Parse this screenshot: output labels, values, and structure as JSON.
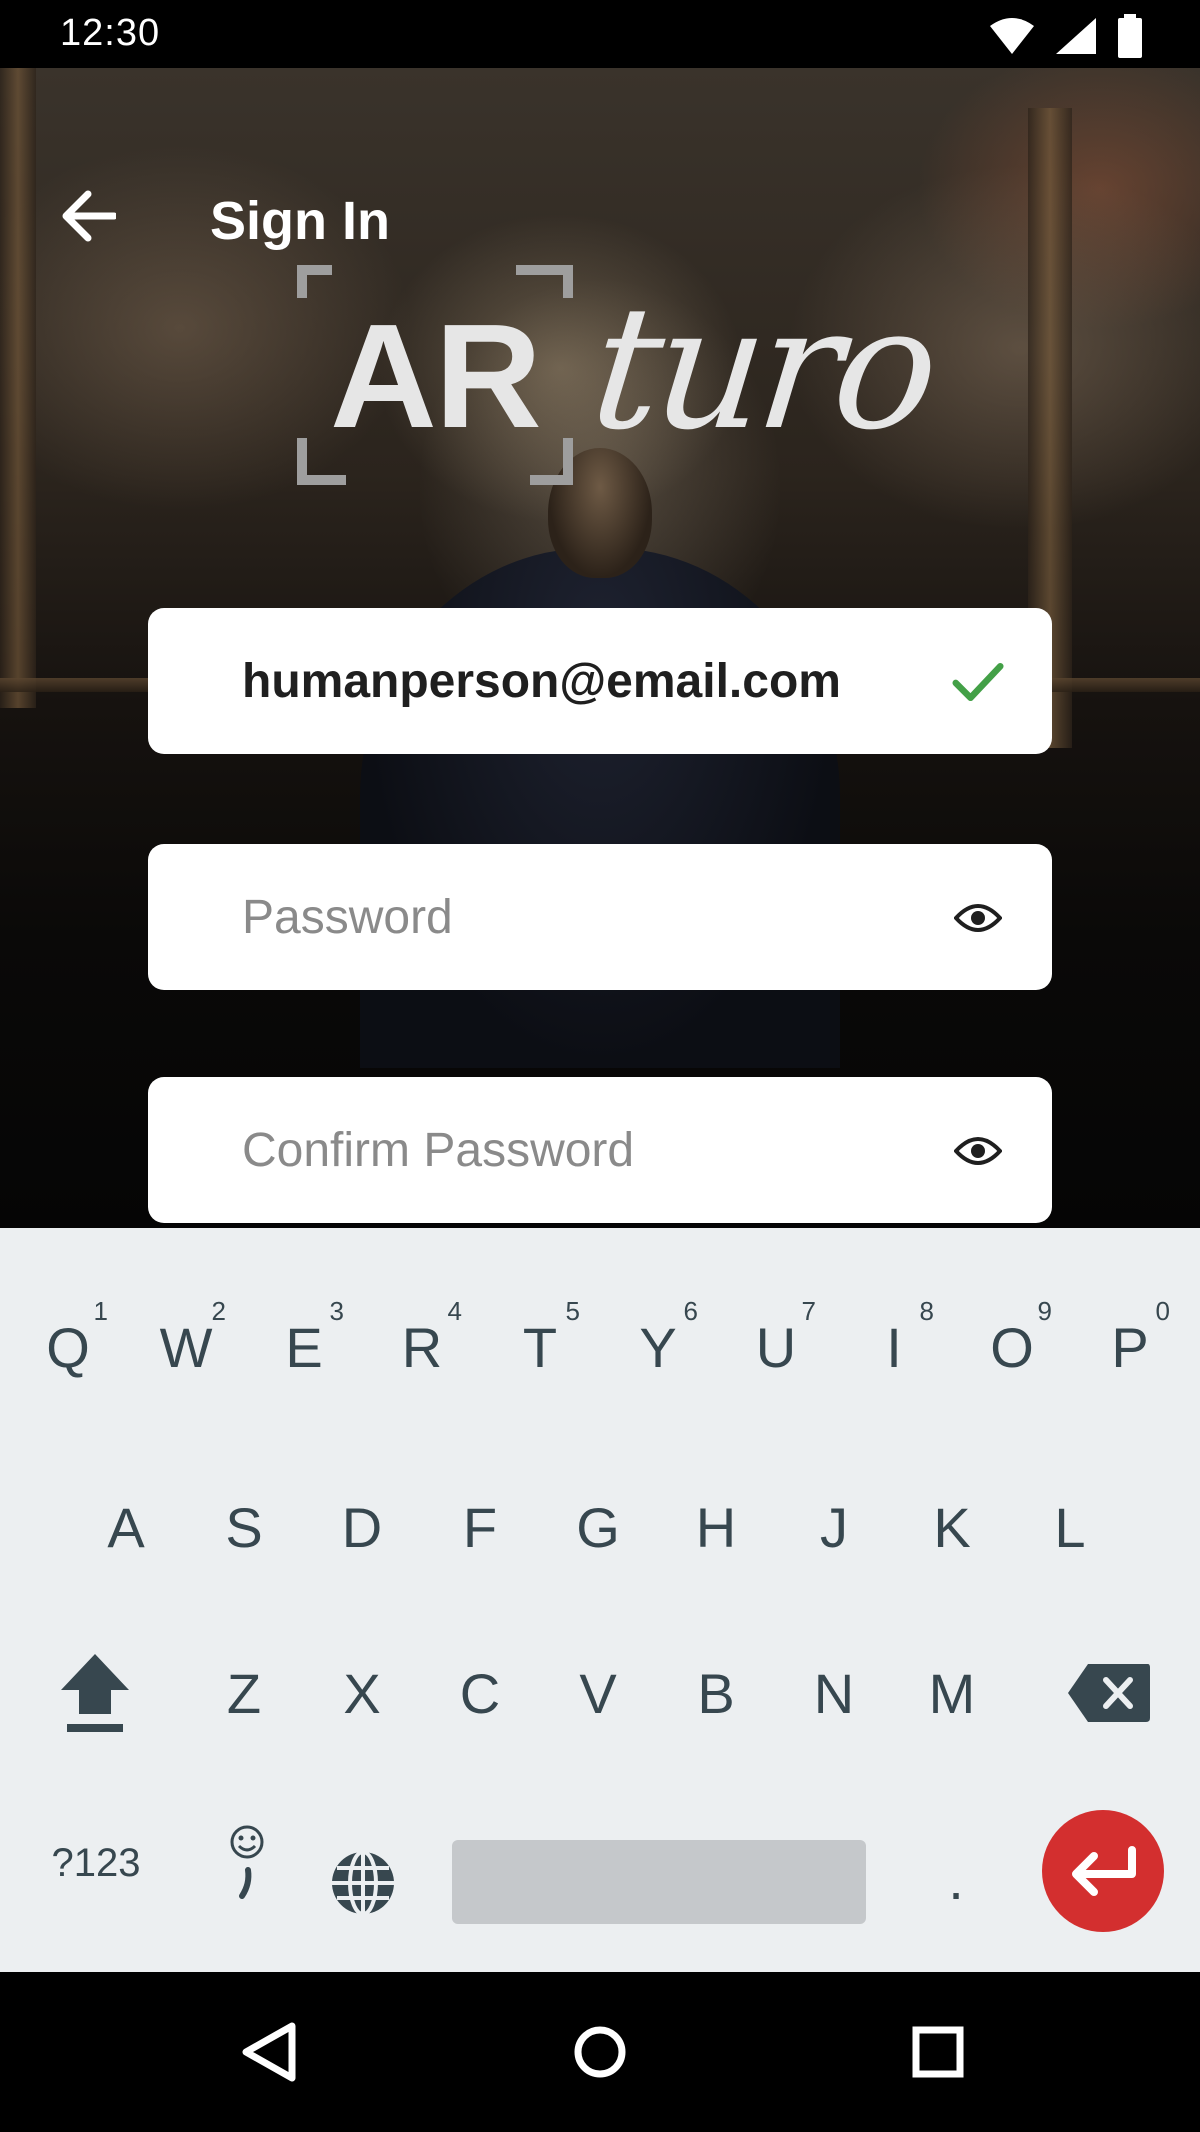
{
  "status_bar": {
    "time": "12:30",
    "icons": [
      "wifi-icon",
      "signal-icon",
      "battery-icon"
    ]
  },
  "app_bar": {
    "title": "Sign In",
    "back_icon": "arrow-left-icon"
  },
  "logo": {
    "ar": "AR",
    "turo": "turo"
  },
  "form": {
    "email": {
      "value": "humanperson@email.com",
      "status_icon": "check-icon",
      "status_color": "#43a047"
    },
    "password": {
      "placeholder": "Password",
      "icon": "eye-icon"
    },
    "confirm_password": {
      "placeholder": "Confirm Password",
      "icon": "eye-icon"
    }
  },
  "keyboard": {
    "row1": [
      {
        "key": "Q",
        "hint": "1"
      },
      {
        "key": "W",
        "hint": "2"
      },
      {
        "key": "E",
        "hint": "3"
      },
      {
        "key": "R",
        "hint": "4"
      },
      {
        "key": "T",
        "hint": "5"
      },
      {
        "key": "Y",
        "hint": "6"
      },
      {
        "key": "U",
        "hint": "7"
      },
      {
        "key": "I",
        "hint": "8"
      },
      {
        "key": "O",
        "hint": "9"
      },
      {
        "key": "P",
        "hint": "0"
      }
    ],
    "row2": [
      "A",
      "S",
      "D",
      "F",
      "G",
      "H",
      "J",
      "K",
      "L"
    ],
    "row3": [
      "Z",
      "X",
      "C",
      "V",
      "B",
      "N",
      "M"
    ],
    "symbols_label": "?123",
    "period_label": ".",
    "enter_color": "#d32f2f",
    "icons": [
      "shift-icon",
      "backspace-icon",
      "emoji-comma-icon",
      "globe-icon",
      "enter-icon"
    ]
  },
  "nav_bar": {
    "icons": [
      "back-triangle-icon",
      "home-circle-icon",
      "recents-square-icon"
    ]
  }
}
